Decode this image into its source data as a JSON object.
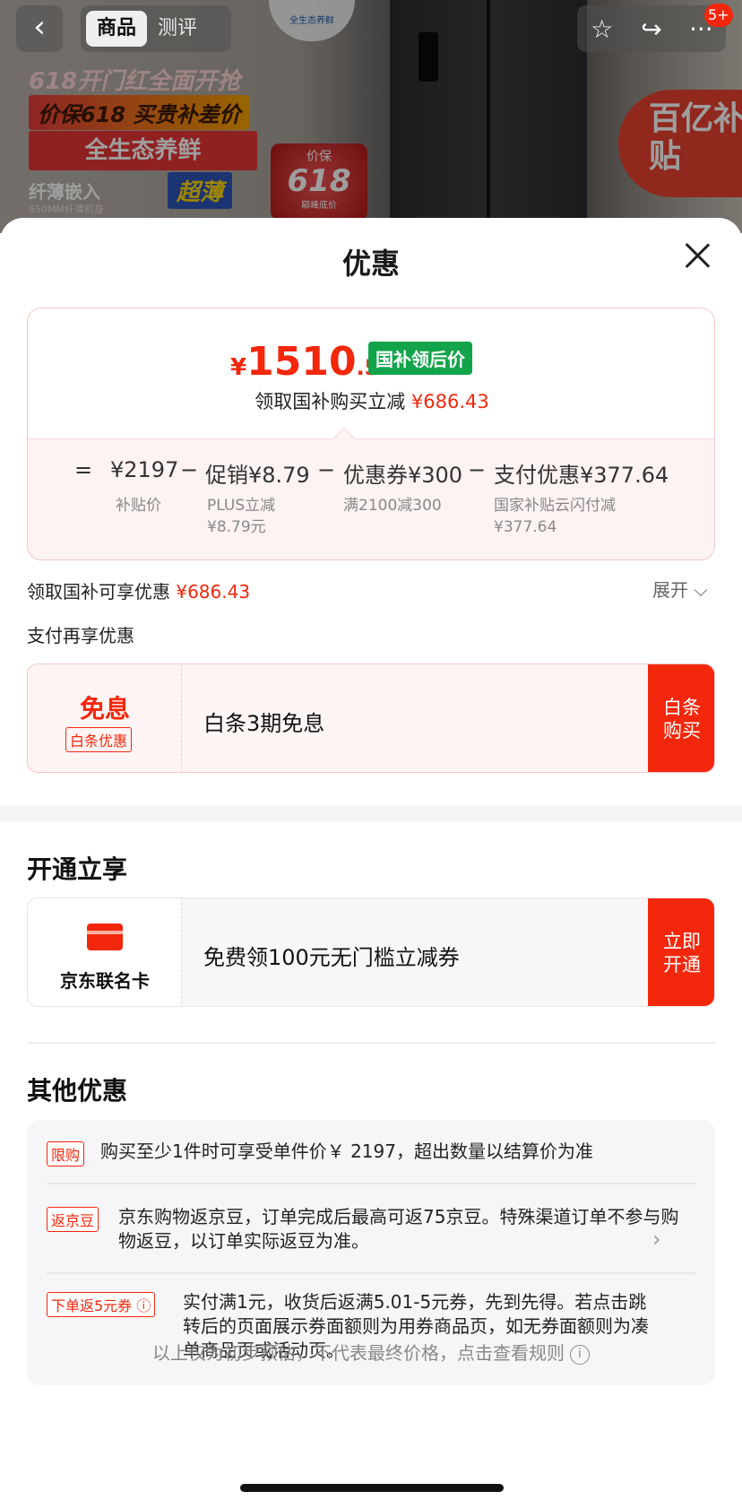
{
  "nav": {
    "tabs": [
      {
        "label": "商品"
      },
      {
        "label": "测评"
      }
    ],
    "cart_count": "5+",
    "icons": [
      "back-icon",
      "star-icon",
      "share-icon",
      "more-icon"
    ]
  },
  "banner": {
    "eco_logo": "全生态养鲜",
    "line1": "618开门红全面开抢",
    "line2": "价保618 买贵补差价",
    "line3": "全生态养鲜",
    "line4": "纤薄嵌入",
    "line5": "650MM纤薄机身",
    "thin": "超薄",
    "badge_small": "价保",
    "badge_big": "618",
    "badge_tiny": "巅峰底价",
    "subsidy": "百亿补贴"
  },
  "sheet": {
    "title": "优惠",
    "price": {
      "yen": "¥",
      "integer": "1510",
      "decimal": ".57",
      "tag": "国补领后价"
    },
    "price_sub": {
      "text": "领取国补购买立减 ",
      "amount": "¥686.43"
    },
    "calc": {
      "eq": "=",
      "items": [
        {
          "value": "¥2197",
          "note": "补贴价"
        },
        {
          "op": "−",
          "value": "促销¥8.79",
          "note": "PLUS立减\n¥8.79元"
        },
        {
          "op": "−",
          "value": "优惠券¥300",
          "note": "满2100减300"
        },
        {
          "op": "−",
          "value": "支付优惠¥377.64",
          "note": "国家补贴云闪付减\n¥377.64"
        }
      ]
    },
    "claim": {
      "text": "领取国补可享优惠 ",
      "amount": "¥686.43",
      "expand": "展开 ⌵"
    },
    "pay_section_label": "支付再享优惠",
    "pay_card": {
      "main": "免息",
      "tag": "白条优惠",
      "text": "白条3期免息",
      "button": "白条\n购买"
    },
    "open_section_label": "开通立享",
    "card_offer": {
      "name": "京东联名卡",
      "text": "免费领100元无门槛立减券",
      "button": "立即\n开通"
    },
    "other_section_label": "其他优惠",
    "others": [
      {
        "tag": "限购",
        "text": "购买至少1件时可享受单件价￥ 2197，超出数量以结算价为准"
      },
      {
        "tag": "返京豆",
        "text": "京东购物返京豆，订单完成后最高可返75京豆。特殊渠道订单不参与购物返豆，以订单实际返豆为准。"
      },
      {
        "tag": "下单返5元券 ⓘ",
        "text": "实付满1元，收货后返满5.01-5元券，先到先得。若点击跳转后的页面展示券面额则为用券商品页，如无券面额则为凑单商品页或活动页。"
      }
    ],
    "footer": "以上仅为初步预估，不代表最终价格，点击查看规则"
  },
  "colors": {
    "accent": "#f2270c",
    "green_tag": "#12a44a",
    "pink_border": "#f3c6c6"
  }
}
